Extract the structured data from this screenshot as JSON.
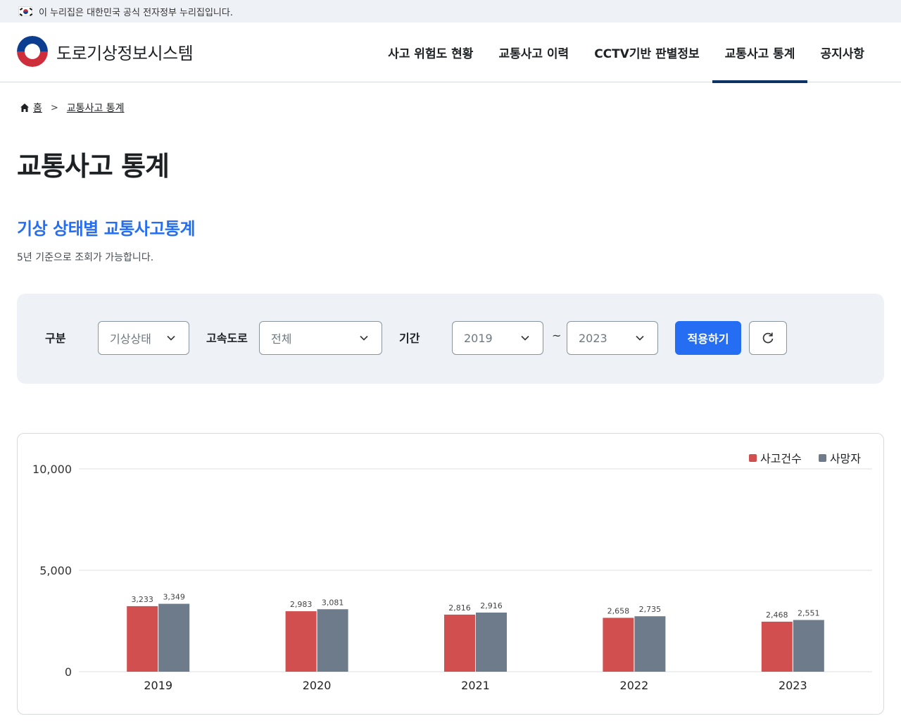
{
  "gov_banner": {
    "text": "이 누리집은 대한민국 공식 전자정부 누리집입니다."
  },
  "header": {
    "logo_text": "도로기상정보시스템",
    "nav": [
      {
        "label": "사고 위험도 현황"
      },
      {
        "label": "교통사고 이력"
      },
      {
        "label": "CCTV기반 판별정보"
      },
      {
        "label": "교통사고 통계",
        "active": true
      },
      {
        "label": "공지사항"
      }
    ]
  },
  "breadcrumb": {
    "home": "홈",
    "current": "교통사고 통계"
  },
  "page_title": "교통사고 통계",
  "section": {
    "title": "기상 상태별 교통사고통계",
    "description": "5년 기준으로 조회가 가능합니다."
  },
  "filters": {
    "category_label": "구분",
    "category_value": "기상상태",
    "highway_label": "고속도로",
    "highway_value": "전체",
    "period_label": "기간",
    "period_from": "2019",
    "period_separator": "~",
    "period_to": "2023",
    "apply_label": "적용하기",
    "reset_icon": "refresh-icon"
  },
  "colors": {
    "accident": "#d14f4f",
    "death": "#6e7b8b",
    "accent": "#256ef4",
    "nav_active": "#0b3464"
  },
  "chart_data": {
    "type": "bar",
    "categories": [
      "2019",
      "2020",
      "2021",
      "2022",
      "2023"
    ],
    "series": [
      {
        "name": "사고건수",
        "values": [
          3233,
          2983,
          2816,
          2658,
          2468
        ],
        "labels": [
          "3,233",
          "2,983",
          "2,816",
          "2,658",
          "2,468"
        ]
      },
      {
        "name": "사망자",
        "values": [
          3349,
          3081,
          2916,
          2735,
          2551
        ],
        "labels": [
          "3,349",
          "3,081",
          "2,916",
          "2,735",
          "2,551"
        ]
      }
    ],
    "yticks": [
      "0",
      "5,000",
      "10,000"
    ],
    "ylim": [
      0,
      10000
    ],
    "legend_position": "top-right",
    "grid": true
  }
}
